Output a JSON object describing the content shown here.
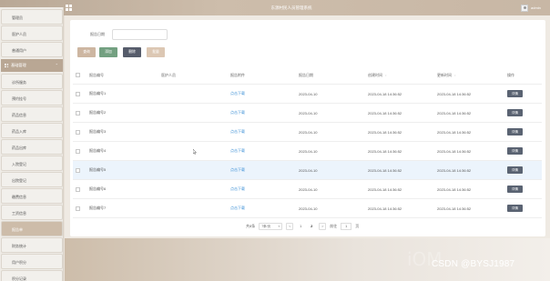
{
  "app": {
    "title": "东源村民人员管理系统",
    "user": "admin"
  },
  "sidebar": {
    "top_items": [
      "管理员",
      "医护人员",
      "普通用户"
    ],
    "group_title": "基础管理",
    "group_items": [
      "诊所服务",
      "预约挂号",
      "药品信息",
      "药品入库",
      "药品出库",
      "入院登记",
      "出院登记",
      "缴费信息",
      "工资信息",
      "报告单",
      "财务统计",
      "用户积分",
      "积分记录"
    ],
    "active_item": "报告单"
  },
  "search": {
    "label": "报告日期",
    "value": "",
    "placeholder": ""
  },
  "toolbar": {
    "query_label": "查询",
    "add_label": "添加",
    "delete_label": "删除",
    "batch_label": "批量"
  },
  "table": {
    "columns": [
      "报告编号",
      "医护人员",
      "报告附件",
      "报告日期",
      "创建时间",
      "更新时间",
      "操作"
    ],
    "sort_marks": {
      "create": "↕",
      "update": "↕"
    },
    "rows": [
      {
        "no": "报告编号1",
        "person": "",
        "attachment": "点击下载",
        "date": "2023-04-10",
        "created": "2023-04-18 14:36:52",
        "updated": "2023-04-18 14:36:52",
        "action": "详情"
      },
      {
        "no": "报告编号2",
        "person": "",
        "attachment": "点击下载",
        "date": "2023-04-10",
        "created": "2023-04-18 14:36:52",
        "updated": "2023-04-18 14:36:52",
        "action": "详情"
      },
      {
        "no": "报告编号3",
        "person": "",
        "attachment": "点击下载",
        "date": "2023-04-10",
        "created": "2023-04-18 14:36:52",
        "updated": "2023-04-18 14:36:52",
        "action": "详情"
      },
      {
        "no": "报告编号4",
        "person": "",
        "attachment": "点击下载",
        "date": "2023-04-10",
        "created": "2023-04-18 14:36:52",
        "updated": "2023-04-18 14:36:52",
        "action": "详情"
      },
      {
        "no": "报告编号5",
        "person": "",
        "attachment": "点击下载",
        "date": "2023-04-10",
        "created": "2023-04-18 14:36:52",
        "updated": "2023-04-18 14:36:52",
        "action": "详情"
      },
      {
        "no": "报告编号6",
        "person": "",
        "attachment": "点击下载",
        "date": "2023-04-10",
        "created": "2023-04-18 14:36:52",
        "updated": "2023-04-18 14:36:52",
        "action": "详情"
      },
      {
        "no": "报告编号7",
        "person": "",
        "attachment": "点击下载",
        "date": "2023-04-10",
        "created": "2023-04-18 14:36:52",
        "updated": "2023-04-18 14:36:52",
        "action": "详情"
      }
    ]
  },
  "pagination": {
    "total_label": "共8条",
    "page_size": "7条/页",
    "prev": "<",
    "pages": [
      "1",
      "2"
    ],
    "current_page": "2",
    "next": ">",
    "goto_label": "前往",
    "goto_value": "1",
    "page_suffix": "页"
  },
  "watermark": {
    "text": "CSDN @BYSJ1987",
    "ghost": "iOM"
  }
}
